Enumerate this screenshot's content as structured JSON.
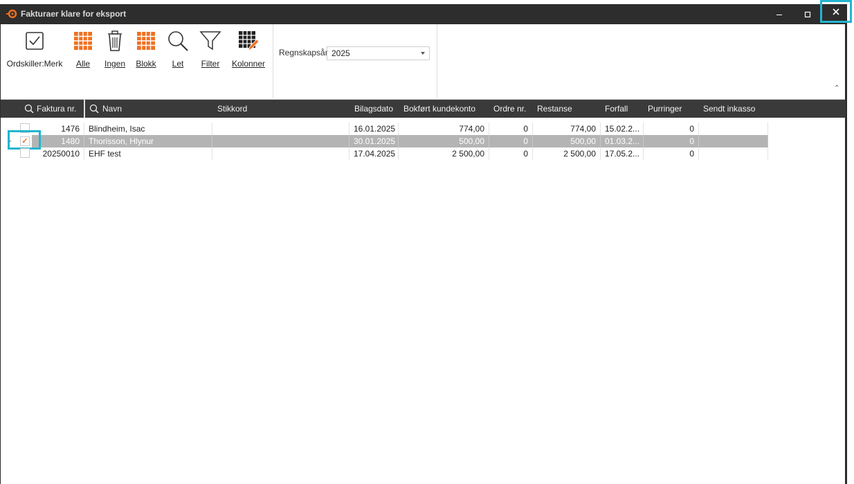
{
  "window": {
    "title": "Fakturaer klare for eksport",
    "min_glyph": "–",
    "max_glyph": "☐",
    "close_glyph": "✕"
  },
  "toolbar": {
    "tools": [
      {
        "label": "Ordskiller:Merk",
        "icon": "checkbox-icon"
      },
      {
        "label": "Alle",
        "icon": "grid-orange-icon"
      },
      {
        "label": "Ingen",
        "icon": "trash-icon"
      },
      {
        "label": "Blokk",
        "icon": "grid-orange-icon"
      },
      {
        "label": "Let",
        "icon": "search-icon"
      },
      {
        "label": "Filter",
        "icon": "filter-icon"
      },
      {
        "label": "Kolonner",
        "icon": "columns-edit-icon"
      }
    ],
    "regnskapsar_label": "Regnskapsår",
    "regnskapsar_value": "2025",
    "collapse_glyph": "⌃"
  },
  "colors": {
    "titlebar": "#2d2d2d",
    "header": "#3a3a3a",
    "accent": "#f07020",
    "highlight": "#22b5d0",
    "selected_row": "#b4b4b4"
  },
  "grid": {
    "columns": [
      "Faktura nr.",
      "Navn",
      "Stikkord",
      "Bilagsdato",
      "Bokført kundekonto",
      "Ordre nr.",
      "Restanse",
      "Forfall",
      "Purringer",
      "Sendt inkasso"
    ],
    "rows": [
      {
        "faktura": "1476",
        "navn": "Blindheim, Isac",
        "stikkord": "",
        "bilagsdato": "16.01.2025",
        "bokfort": "774,00",
        "ordre": "0",
        "restanse": "774,00",
        "forfall": "15.02.2...",
        "purringer": "0",
        "inkasso": "",
        "checked": false,
        "selected": false
      },
      {
        "faktura": "1480",
        "navn": "Thorisson, Hlynur",
        "stikkord": "",
        "bilagsdato": "30.01.2025",
        "bokfort": "500,00",
        "ordre": "0",
        "restanse": "500,00",
        "forfall": "01.03.2...",
        "purringer": "0",
        "inkasso": "",
        "checked": true,
        "selected": true
      },
      {
        "faktura": "20250010",
        "navn": "EHF test",
        "stikkord": "",
        "bilagsdato": "17.04.2025",
        "bokfort": "2 500,00",
        "ordre": "0",
        "restanse": "2 500,00",
        "forfall": "17.05.2...",
        "purringer": "0",
        "inkasso": "",
        "checked": false,
        "selected": false
      }
    ],
    "check_glyph": "✓",
    "row_pointer_glyph": "▸"
  }
}
